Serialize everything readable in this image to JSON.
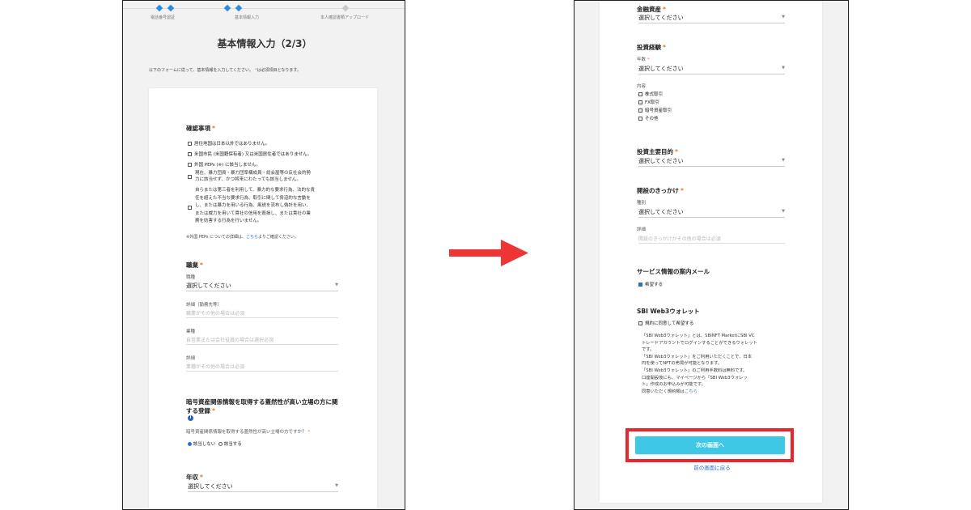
{
  "left": {
    "steps": [
      "電話番号認証",
      "基本情報入力",
      "本人確認書類アップロード"
    ],
    "title": "基本情報入力（2/3）",
    "intro": "以下のフォームに従って、基本情報を入力してください。",
    "required_note": "は必須項目となります。",
    "required_mark": "*",
    "confirm": {
      "heading": "確認事項",
      "items": [
        "居住地国は日本以外ではありません。",
        "米国市民 (米国籍保有者) 又は米国居住者ではありません。",
        "外国 PEPs (※) に該当しません。",
        "現在、暴力団員・暴力団準構成員・総会屋等の反社会的勢",
        "力に該当せず、かつ将来にわたっても該当しません。"
      ],
      "long_item": [
        "自らまたは第三者を利用して、暴力的な要求行為、法的な責",
        "任を超えた不当な要求行為、取引に関して脅迫的な言動を",
        "し、または暴力を用いる行為、風説を流布し偽計を用い、",
        "または威力を用いて貴社の信用を毀損し、または貴社の業",
        "務を妨害する行為を行いません。"
      ],
      "note_prefix": "※外国 PEPs についての詳細は、",
      "note_link": "こちら",
      "note_suffix": "よりご確認ください。"
    },
    "occupation": {
      "heading": "職業",
      "type_label": "職種",
      "type_value": "選択してください",
      "detail1_label": "詳細（勤務先等）",
      "detail1_placeholder": "職業がその他の場合は必須",
      "industry_label": "業種",
      "industry_placeholder": "自営業または会社役員の場合は選択必須",
      "detail2_label": "詳細",
      "detail2_placeholder": "業種がその他の場合は必須"
    },
    "crypto": {
      "heading1": "暗号資産関係情報を取得する蓋然性が高い立場の方に関",
      "heading2": "する登録",
      "question": "暗号資産関係情報を取得する蓋然性が高い立場の方ですか？",
      "opt_no": "該当しない",
      "opt_yes": "該当する",
      "info_icon": "info-icon"
    },
    "income": {
      "heading": "年収",
      "value": "選択してください"
    }
  },
  "right": {
    "assets": {
      "heading": "金融資産",
      "value": "選択してください"
    },
    "experience": {
      "heading": "投資経験",
      "years_label": "年数",
      "years_value": "選択してください",
      "content_label": "内容",
      "items": [
        "株式取引",
        "FX取引",
        "暗号資産取引",
        "その他"
      ]
    },
    "purpose": {
      "heading": "投資主要目的",
      "value": "選択してください"
    },
    "trigger": {
      "heading": "開設のきっかけ",
      "type_label": "種別",
      "type_value": "選択してください",
      "detail_label": "詳細",
      "detail_placeholder": "開設のきっかけがその他の場合は必須"
    },
    "mail": {
      "heading": "サービス情報の案内メール",
      "option": "希望する",
      "checked": true
    },
    "wallet": {
      "heading": "SBI Web3ウォレット",
      "option": "規約に同意して希望する",
      "lines": [
        "「SBI Web3ウォレット」とは、SBINFT MarketにSBI VC",
        "トレードアカウントでログインすることができるウォレット",
        "です。",
        "「SBI Web3ウォレット」をご利用いただくことで、日本",
        "円を使ってNFTの売買が可能となります。",
        "「SBI Web3ウォレット」のご利用手数料は無料です。",
        "口座開設後にも、マイページから「SBI Web3ウォレッ",
        "ト」作成のお申込みが可能です。"
      ],
      "terms_prefix": "同意いただく規約類は",
      "terms_link": "こちら"
    },
    "next_button": "次の画面へ",
    "back_link": "前の画面に戻る"
  },
  "colors": {
    "accent": "#2b8be0",
    "button": "#3ec8e6",
    "highlight": "#e8262b",
    "arrow": "#ee3535"
  }
}
